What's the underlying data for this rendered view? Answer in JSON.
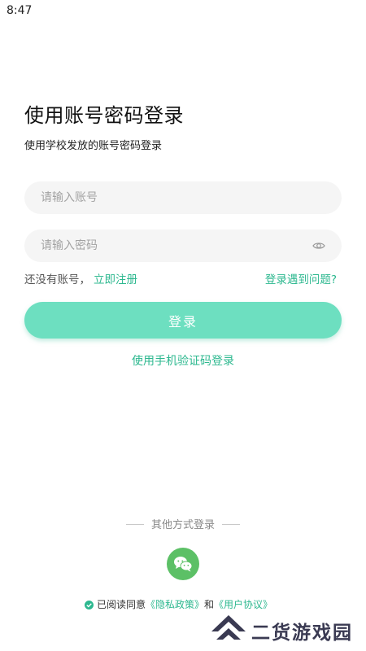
{
  "status_bar": {
    "time": "8:47"
  },
  "header": {
    "title": "使用账号密码登录",
    "subtitle": "使用学校发放的账号密码登录"
  },
  "form": {
    "account_placeholder": "请输入账号",
    "password_placeholder": "请输入密码",
    "no_account_text": "还没有账号，",
    "register_link": "立即注册",
    "problem_link": "登录遇到问题?",
    "login_button": "登录",
    "sms_login_link": "使用手机验证码登录"
  },
  "other_login": {
    "label": "其他方式登录",
    "wechat_icon": "wechat-icon"
  },
  "agreement": {
    "prefix": "已阅读同意",
    "privacy_link": "《隐私政策》",
    "and": "和",
    "terms_link": "《用户协议》",
    "checked": true
  },
  "watermark": {
    "text": "二货游戏园"
  },
  "colors": {
    "accent": "#2db88f",
    "button": "#6ddfc0",
    "input_bg": "#f5f5f5",
    "wechat": "#5cc066"
  }
}
